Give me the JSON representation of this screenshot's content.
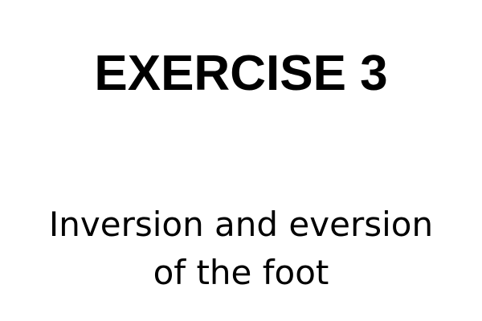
{
  "slide": {
    "title": "EXERCISE 3",
    "subtitle_line1": "Inversion and eversion",
    "subtitle_line2": "of the foot"
  },
  "colors": {
    "background": "#ffffff",
    "text": "#000000"
  }
}
